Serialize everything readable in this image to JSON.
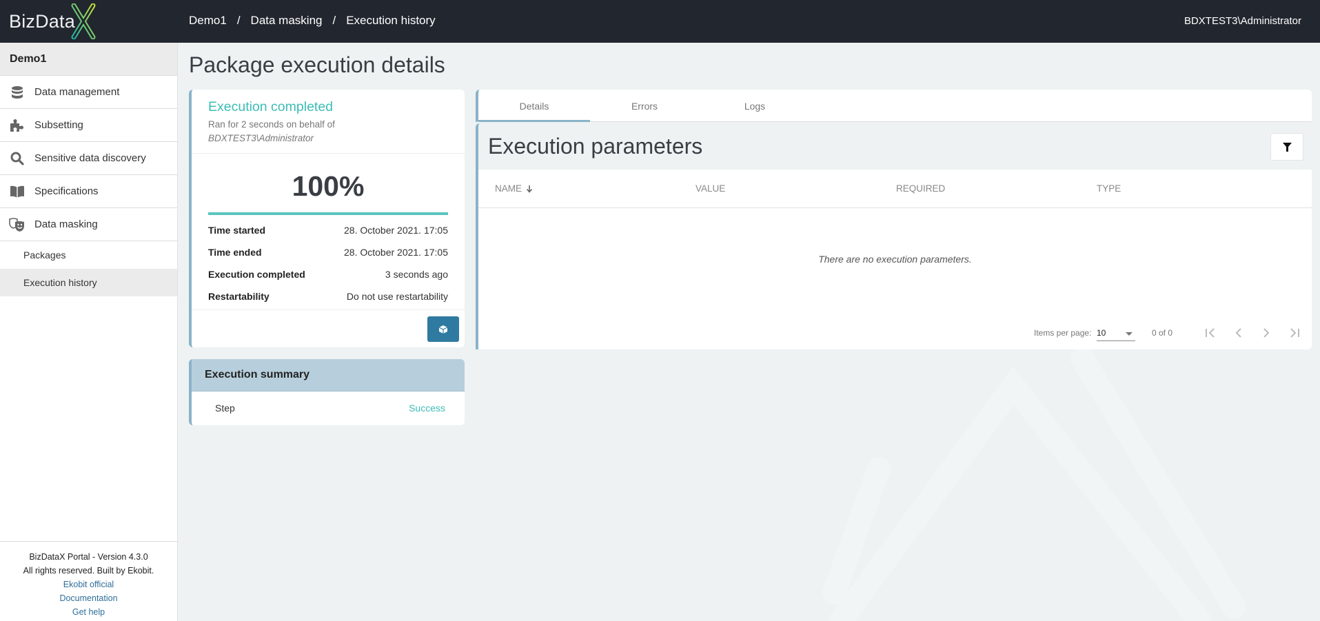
{
  "header": {
    "logo_text": "BizData",
    "logo_mark": "X",
    "breadcrumb": [
      "Demo1",
      "Data masking",
      "Execution history"
    ],
    "breadcrumb_separator": "/",
    "user": "BDXTEST3\\Administrator"
  },
  "sidebar": {
    "project": "Demo1",
    "items": [
      {
        "label": "Data management",
        "icon": "database-icon"
      },
      {
        "label": "Subsetting",
        "icon": "puzzle-icon"
      },
      {
        "label": "Sensitive data discovery",
        "icon": "search-icon"
      },
      {
        "label": "Specifications",
        "icon": "book-icon"
      },
      {
        "label": "Data masking",
        "icon": "theater-masks-icon"
      }
    ],
    "subitems": [
      {
        "label": "Packages",
        "active": false
      },
      {
        "label": "Execution history",
        "active": true
      }
    ],
    "footer": {
      "version": "BizDataX Portal - Version 4.3.0",
      "rights": "All rights reserved. Built by Ekobit.",
      "links": [
        "Ekobit official",
        "Documentation",
        "Get help"
      ]
    }
  },
  "page": {
    "title": "Package execution details"
  },
  "status_card": {
    "title": "Execution completed",
    "subtitle": "Ran for 2 seconds on behalf of",
    "user": "BDXTEST3\\Administrator",
    "percent_label": "100%",
    "progress": 1.0,
    "rows": [
      {
        "key": "Time started",
        "value": "28. October 2021. 17:05"
      },
      {
        "key": "Time ended",
        "value": "28. October 2021. 17:05"
      },
      {
        "key": "Execution completed",
        "value": "3 seconds ago"
      },
      {
        "key": "Restartability",
        "value": "Do not use restartability"
      }
    ],
    "package_button_icon": "cube-icon"
  },
  "summary": {
    "title": "Execution summary",
    "rows": [
      {
        "step": "Step",
        "status": "Success"
      }
    ]
  },
  "tabs": [
    {
      "label": "Details",
      "active": true
    },
    {
      "label": "Errors",
      "active": false
    },
    {
      "label": "Logs",
      "active": false
    }
  ],
  "params": {
    "title": "Execution parameters",
    "columns": [
      "NAME",
      "VALUE",
      "REQUIRED",
      "TYPE"
    ],
    "sort_column": "NAME",
    "empty_message": "There are no execution parameters.",
    "paginator": {
      "items_per_page_label": "Items per page:",
      "items_per_page": "10",
      "range": "0 of 0"
    }
  },
  "colors": {
    "header_bg": "#22262e",
    "accent_teal": "#3dbcb6",
    "accent_blue": "#2f7aa0",
    "card_border": "#89b3c9",
    "summary_header": "#b7cfdc"
  }
}
